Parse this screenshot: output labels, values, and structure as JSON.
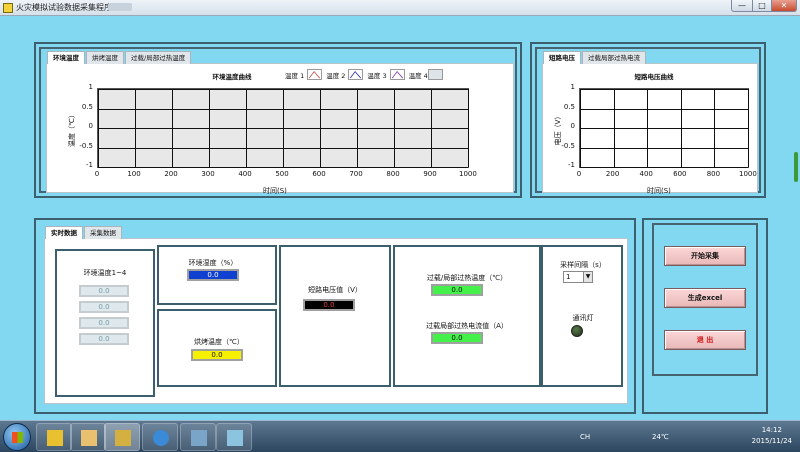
{
  "window": {
    "title": "火灾模拟试验数据采集程序.vi",
    "min": "—",
    "max": "□",
    "close": "✕"
  },
  "left_chart": {
    "tabs": [
      "环境温度",
      "烘烤温度",
      "过载/局部过热温度"
    ],
    "title": "环境温度曲线",
    "xlabel": "时间(S)",
    "ylabel": "温度（℃）",
    "legend": [
      "温度 1",
      "温度 2",
      "温度 3",
      "温度 4"
    ],
    "legend_colors": [
      "#c05050",
      "#3030b0",
      "#8040a0",
      "#999999"
    ],
    "xticks": [
      "0",
      "100",
      "200",
      "300",
      "400",
      "500",
      "600",
      "700",
      "800",
      "900",
      "1000"
    ],
    "yticks": [
      "1",
      "0.5",
      "0",
      "-0.5",
      "-1"
    ]
  },
  "right_chart": {
    "tabs": [
      "短路电压",
      "过载局部过热电流"
    ],
    "title": "短路电压曲线",
    "xlabel": "时间(S)",
    "ylabel": "电压（V）",
    "xticks": [
      "0",
      "200",
      "400",
      "600",
      "800",
      "1000"
    ],
    "yticks": [
      "1",
      "0.5",
      "0",
      "-0.5",
      "-1"
    ]
  },
  "chart_data": [
    {
      "type": "line",
      "title": "环境温度曲线",
      "xlabel": "时间(S)",
      "ylabel": "温度（℃）",
      "xlim": [
        0,
        1000
      ],
      "ylim": [
        -1,
        1
      ],
      "grid": true,
      "legend": "top-right",
      "series": []
    },
    {
      "type": "line",
      "title": "短路电压曲线",
      "xlabel": "时间(S)",
      "ylabel": "电压（V）",
      "xlim": [
        0,
        1000
      ],
      "ylim": [
        -1,
        1
      ],
      "grid": true,
      "series": []
    }
  ],
  "data_panel": {
    "tabs": [
      "实时数据",
      "采集数据"
    ],
    "env_temp_label": "环境温度1~4",
    "env_temp_values": [
      "0.0",
      "0.0",
      "0.0",
      "0.0"
    ],
    "humidity_label": "环境湿度（%）",
    "humidity_value": "0.0",
    "bake_label": "烘烤温度（℃）",
    "bake_value": "0.0",
    "short_label": "短路电压值（V）",
    "short_value": "0.0",
    "overload_temp_label": "过载/局部过热温度（℃）",
    "overload_temp_value": "0.0",
    "overload_current_label": "过载局部过热电流值（A）",
    "overload_current_value": "0.0",
    "sample_label": "采样间隔（s）",
    "sample_value": "1",
    "comm_label": "通讯灯"
  },
  "buttons": {
    "start": "开始采集",
    "excel": "生成excel",
    "exit": "退    出"
  },
  "taskbar": {
    "lang": "CH",
    "temp": "24℃",
    "time": "14:12",
    "date": "2015/11/24"
  }
}
